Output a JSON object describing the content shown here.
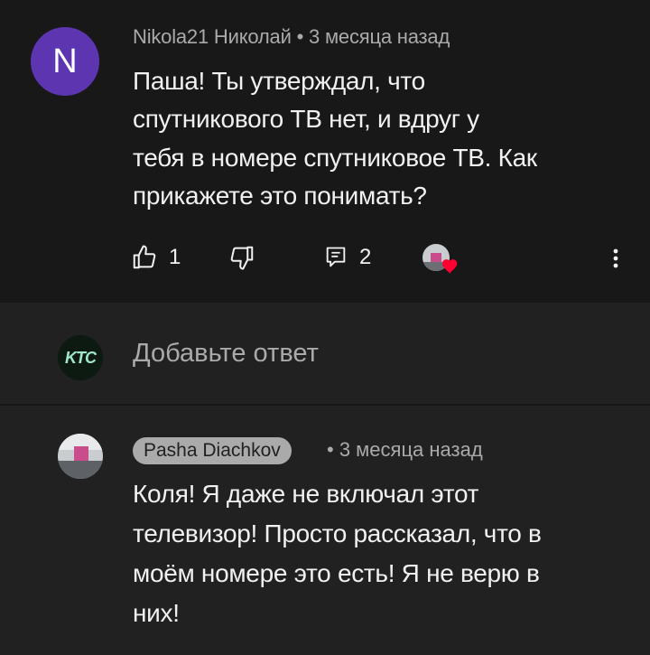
{
  "comment": {
    "author": "Nikola21 Николай",
    "time": "3 месяца назад",
    "avatar_letter": "N",
    "lines": [
      "Паша! Ты утверждал, что",
      "спутникового ТВ нет, и вдруг у",
      "тебя в номере спутниковое ТВ. Как",
      "прикажете это понимать?"
    ],
    "like_count": "1",
    "reply_count": "2",
    "icons": [
      "like-icon",
      "dislike-icon",
      "replies-icon",
      "creator-heart-icon",
      "more-vert-icon"
    ]
  },
  "reply_input": {
    "placeholder": "Добавьте ответ",
    "avatar_text": "KTC"
  },
  "reply": {
    "author": "Pasha Diachkov",
    "time": "3 месяца назад",
    "lines": [
      "Коля! Я даже не включал этот",
      "телевизор! Просто рассказал, что в",
      "моём номере это есть! Я не верю в",
      "них!"
    ]
  },
  "colors": {
    "background": "#212121",
    "highlight_bg": "#181818",
    "avatar_purple": "#5e35b1",
    "secondary_text": "#aaaaaa",
    "heart_red": "#ff0033"
  }
}
